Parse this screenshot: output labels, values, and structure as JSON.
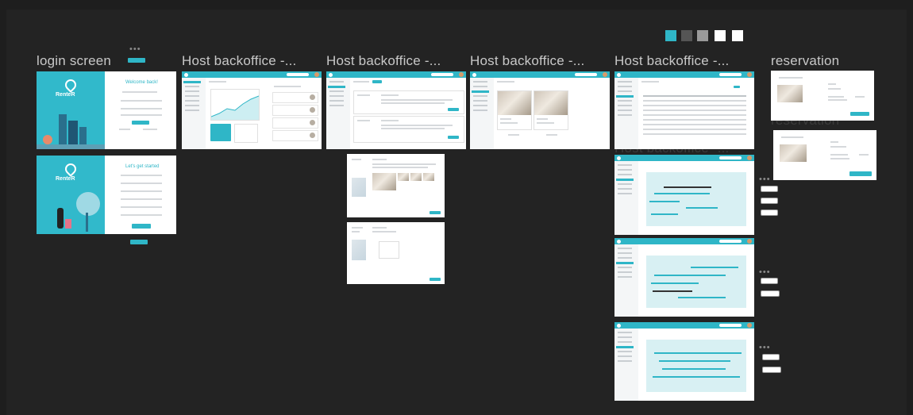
{
  "frames": {
    "login": "login screen",
    "host1": "Host backoffice -...",
    "host2": "Host backoffice -...",
    "host3": "Host backoffice -...",
    "host4": "Host backoffice -...",
    "reservation": "reservation"
  },
  "app": {
    "logo": "RenteR",
    "welcome": "Welcome back!",
    "started": "Let's get started"
  },
  "swatch_colors": [
    "#2fb6c7",
    "#555555",
    "#9a9a9a",
    "#ffffff",
    "#ffffff"
  ],
  "icons": [
    "location-pin-icon",
    "avatar-icon",
    "search-icon",
    "ellipsis-icon"
  ]
}
